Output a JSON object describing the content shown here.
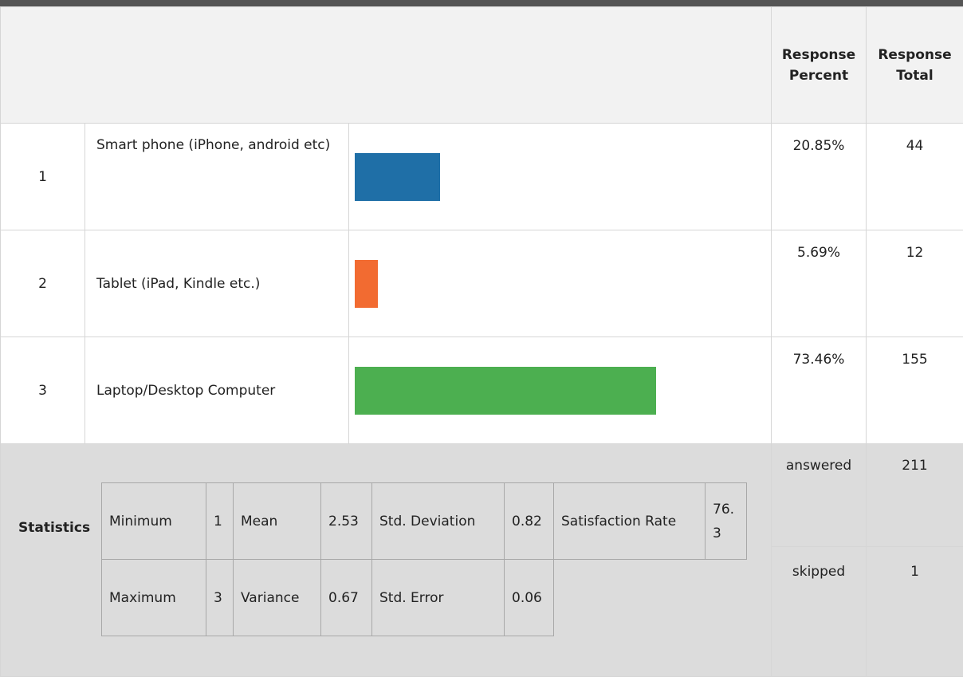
{
  "header": {
    "response_percent": "Response Percent",
    "response_total": "Response Total"
  },
  "rows": [
    {
      "index": "1",
      "label": "Smart phone (iPhone, android etc)",
      "percent": "20.85%",
      "total": "44",
      "color": "#1f6fa7"
    },
    {
      "index": "2",
      "label": "Tablet (iPad, Kindle etc.)",
      "percent": "5.69%",
      "total": "12",
      "color": "#f26b31"
    },
    {
      "index": "3",
      "label": "Laptop/Desktop Computer",
      "percent": "73.46%",
      "total": "155",
      "color": "#4caf50"
    }
  ],
  "chart_data": {
    "type": "bar",
    "categories": [
      "Smart phone (iPhone, android etc)",
      "Tablet (iPad, Kindle etc.)",
      "Laptop/Desktop Computer"
    ],
    "values": [
      20.85,
      5.69,
      73.46
    ],
    "ylim": [
      0,
      100
    ]
  },
  "summary": {
    "answered_label": "answered",
    "answered_value": "211",
    "skipped_label": "skipped",
    "skipped_value": "1"
  },
  "statistics": {
    "label": "Statistics",
    "minimum_label": "Minimum",
    "minimum_value": "1",
    "mean_label": "Mean",
    "mean_value": "2.53",
    "std_dev_label": "Std. Deviation",
    "std_dev_value": "0.82",
    "satisfaction_label": "Satisfaction Rate",
    "satisfaction_value": "76.3",
    "maximum_label": "Maximum",
    "maximum_value": "3",
    "variance_label": "Variance",
    "variance_value": "0.67",
    "std_err_label": "Std. Error",
    "std_err_value": "0.06"
  }
}
